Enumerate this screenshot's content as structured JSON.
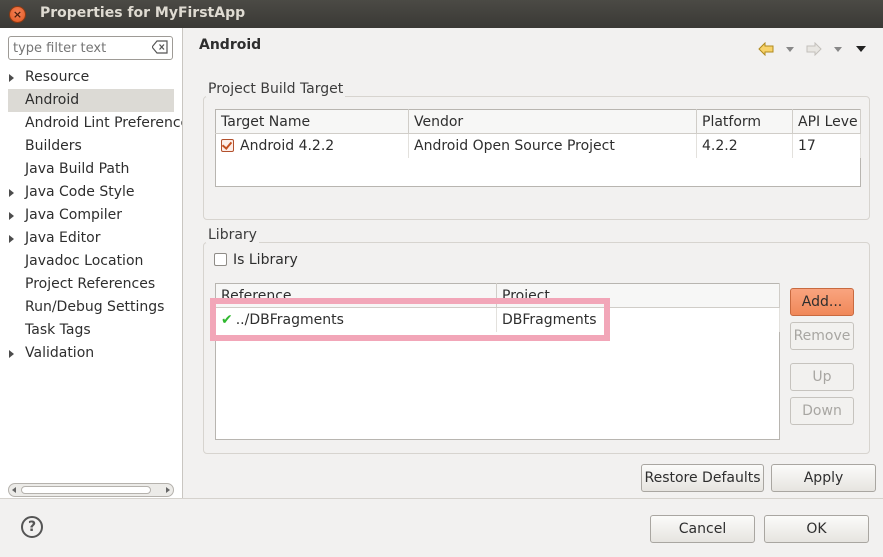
{
  "window": {
    "title": "Properties for MyFirstApp",
    "close_glyph": "×"
  },
  "sidebar": {
    "filter_placeholder": "type filter text",
    "items": [
      {
        "label": "Resource",
        "expandable": true
      },
      {
        "label": "Android",
        "expandable": false,
        "selected": true
      },
      {
        "label": "Android Lint Preferences",
        "expandable": false
      },
      {
        "label": "Builders",
        "expandable": false
      },
      {
        "label": "Java Build Path",
        "expandable": false
      },
      {
        "label": "Java Code Style",
        "expandable": true
      },
      {
        "label": "Java Compiler",
        "expandable": true
      },
      {
        "label": "Java Editor",
        "expandable": true
      },
      {
        "label": "Javadoc Location",
        "expandable": false
      },
      {
        "label": "Project References",
        "expandable": false
      },
      {
        "label": "Run/Debug Settings",
        "expandable": false
      },
      {
        "label": "Task Tags",
        "expandable": false
      },
      {
        "label": "Validation",
        "expandable": true
      }
    ]
  },
  "page": {
    "title": "Android"
  },
  "build_target": {
    "group_label": "Project Build Target",
    "columns": [
      "Target Name",
      "Vendor",
      "Platform",
      "API Leve"
    ],
    "rows": [
      {
        "checked": true,
        "target": "Android 4.2.2",
        "vendor": "Android Open Source Project",
        "platform": "4.2.2",
        "api": "17"
      }
    ]
  },
  "library": {
    "group_label": "Library",
    "is_library_label": "Is Library",
    "is_library_checked": false,
    "columns": [
      "Reference",
      "Project"
    ],
    "rows": [
      {
        "reference": "../DBFragments",
        "project": "DBFragments",
        "status_glyph": "✔"
      }
    ],
    "buttons": {
      "add": "Add...",
      "remove": "Remove",
      "up": "Up",
      "down": "Down"
    }
  },
  "actions": {
    "restore_defaults": "Restore Defaults",
    "apply": "Apply"
  },
  "footer": {
    "help_glyph": "?",
    "cancel": "Cancel",
    "ok": "OK"
  },
  "colors": {
    "accent_button": "#f08859",
    "highlight_border": "#f2a6b8",
    "check_green": "#2fb82f"
  }
}
